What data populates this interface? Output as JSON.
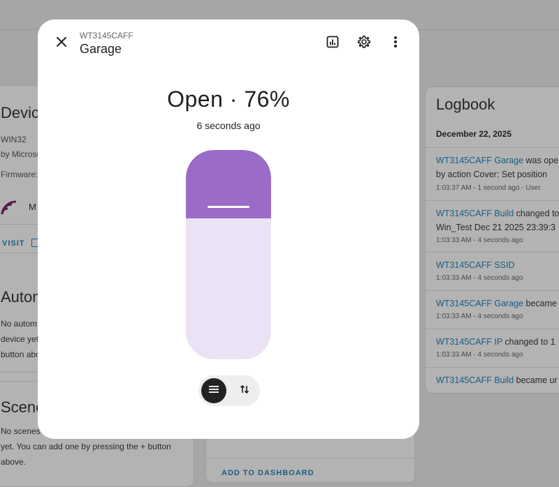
{
  "background": {
    "device_card": {
      "title": "Device",
      "line1": "WIN32",
      "line2": "by Microso",
      "line3": "Firmware:",
      "m_label": "M",
      "visit": "VISIT"
    },
    "automations": {
      "title": "Autom",
      "text_lines": [
        "No autom",
        "device yet",
        "button abo"
      ]
    },
    "scenes": {
      "title": "Scene",
      "text_lines": [
        "No scenes",
        "yet. You can add one by pressing the + button",
        "above."
      ]
    },
    "add_to_dashboard": "ADD TO DASHBOARD",
    "logbook": {
      "title": "Logbook",
      "date": "December 22, 2025",
      "entries": [
        {
          "entity": "WT3145CAFF Garage",
          "text": " was ope",
          "text2": "by action Cover: Set position",
          "sub": "1:03:37 AM - 1 second ago - User"
        },
        {
          "entity": "WT3145CAFF Build",
          "text": " changed to",
          "text2": "Win_Test Dec 21 2025 23:39:3",
          "sub": "1:03:33 AM - 4 seconds ago"
        },
        {
          "entity": "WT3145CAFF SSID",
          "text": "",
          "text2": "",
          "sub": "1:03:33 AM - 4 seconds ago"
        },
        {
          "entity": "WT3145CAFF Garage",
          "text": " became",
          "text2": "",
          "sub": "1:03:33 AM - 4 seconds ago"
        },
        {
          "entity": "WT3145CAFF IP",
          "text": " changed to 1",
          "text2": "",
          "sub": "1:03:33 AM - 4 seconds ago"
        },
        {
          "entity": "WT3145CAFF Build",
          "text": " became ur",
          "text2": "",
          "sub": ""
        }
      ]
    }
  },
  "dialog": {
    "device_name": "WT3145CAFF",
    "entity_name": "Garage",
    "state_text": "Open · 76%",
    "last_changed": "6 seconds ago",
    "position_percent": 76,
    "accent_color": "#9a6cc8",
    "track_color": "#ebe2f5",
    "icons": {
      "close": "close-icon",
      "history": "chart-box-icon",
      "settings": "cog-icon",
      "more": "dots-vertical-icon",
      "mode_position": "menu-icon",
      "mode_buttons": "arrow-up-down-icon"
    }
  }
}
